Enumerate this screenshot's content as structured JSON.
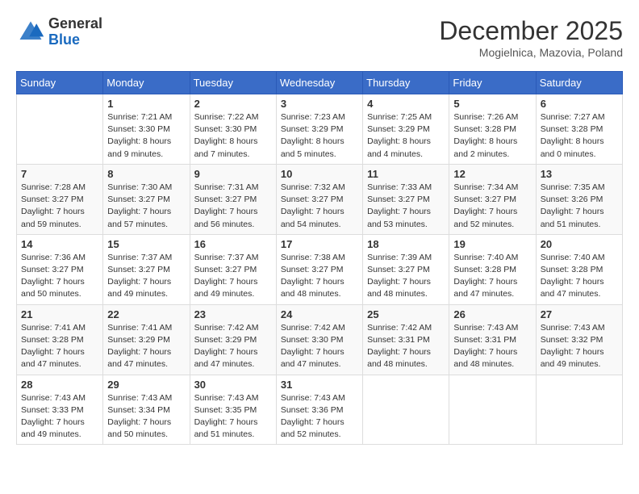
{
  "header": {
    "logo": {
      "general": "General",
      "blue": "Blue"
    },
    "title": "December 2025",
    "subtitle": "Mogielnica, Mazovia, Poland"
  },
  "calendar": {
    "weekdays": [
      "Sunday",
      "Monday",
      "Tuesday",
      "Wednesday",
      "Thursday",
      "Friday",
      "Saturday"
    ],
    "weeks": [
      [
        {
          "day": "",
          "sunrise": "",
          "sunset": "",
          "daylight": ""
        },
        {
          "day": "1",
          "sunrise": "Sunrise: 7:21 AM",
          "sunset": "Sunset: 3:30 PM",
          "daylight": "Daylight: 8 hours and 9 minutes."
        },
        {
          "day": "2",
          "sunrise": "Sunrise: 7:22 AM",
          "sunset": "Sunset: 3:30 PM",
          "daylight": "Daylight: 8 hours and 7 minutes."
        },
        {
          "day": "3",
          "sunrise": "Sunrise: 7:23 AM",
          "sunset": "Sunset: 3:29 PM",
          "daylight": "Daylight: 8 hours and 5 minutes."
        },
        {
          "day": "4",
          "sunrise": "Sunrise: 7:25 AM",
          "sunset": "Sunset: 3:29 PM",
          "daylight": "Daylight: 8 hours and 4 minutes."
        },
        {
          "day": "5",
          "sunrise": "Sunrise: 7:26 AM",
          "sunset": "Sunset: 3:28 PM",
          "daylight": "Daylight: 8 hours and 2 minutes."
        },
        {
          "day": "6",
          "sunrise": "Sunrise: 7:27 AM",
          "sunset": "Sunset: 3:28 PM",
          "daylight": "Daylight: 8 hours and 0 minutes."
        }
      ],
      [
        {
          "day": "7",
          "sunrise": "Sunrise: 7:28 AM",
          "sunset": "Sunset: 3:27 PM",
          "daylight": "Daylight: 7 hours and 59 minutes."
        },
        {
          "day": "8",
          "sunrise": "Sunrise: 7:30 AM",
          "sunset": "Sunset: 3:27 PM",
          "daylight": "Daylight: 7 hours and 57 minutes."
        },
        {
          "day": "9",
          "sunrise": "Sunrise: 7:31 AM",
          "sunset": "Sunset: 3:27 PM",
          "daylight": "Daylight: 7 hours and 56 minutes."
        },
        {
          "day": "10",
          "sunrise": "Sunrise: 7:32 AM",
          "sunset": "Sunset: 3:27 PM",
          "daylight": "Daylight: 7 hours and 54 minutes."
        },
        {
          "day": "11",
          "sunrise": "Sunrise: 7:33 AM",
          "sunset": "Sunset: 3:27 PM",
          "daylight": "Daylight: 7 hours and 53 minutes."
        },
        {
          "day": "12",
          "sunrise": "Sunrise: 7:34 AM",
          "sunset": "Sunset: 3:27 PM",
          "daylight": "Daylight: 7 hours and 52 minutes."
        },
        {
          "day": "13",
          "sunrise": "Sunrise: 7:35 AM",
          "sunset": "Sunset: 3:26 PM",
          "daylight": "Daylight: 7 hours and 51 minutes."
        }
      ],
      [
        {
          "day": "14",
          "sunrise": "Sunrise: 7:36 AM",
          "sunset": "Sunset: 3:27 PM",
          "daylight": "Daylight: 7 hours and 50 minutes."
        },
        {
          "day": "15",
          "sunrise": "Sunrise: 7:37 AM",
          "sunset": "Sunset: 3:27 PM",
          "daylight": "Daylight: 7 hours and 49 minutes."
        },
        {
          "day": "16",
          "sunrise": "Sunrise: 7:37 AM",
          "sunset": "Sunset: 3:27 PM",
          "daylight": "Daylight: 7 hours and 49 minutes."
        },
        {
          "day": "17",
          "sunrise": "Sunrise: 7:38 AM",
          "sunset": "Sunset: 3:27 PM",
          "daylight": "Daylight: 7 hours and 48 minutes."
        },
        {
          "day": "18",
          "sunrise": "Sunrise: 7:39 AM",
          "sunset": "Sunset: 3:27 PM",
          "daylight": "Daylight: 7 hours and 48 minutes."
        },
        {
          "day": "19",
          "sunrise": "Sunrise: 7:40 AM",
          "sunset": "Sunset: 3:28 PM",
          "daylight": "Daylight: 7 hours and 47 minutes."
        },
        {
          "day": "20",
          "sunrise": "Sunrise: 7:40 AM",
          "sunset": "Sunset: 3:28 PM",
          "daylight": "Daylight: 7 hours and 47 minutes."
        }
      ],
      [
        {
          "day": "21",
          "sunrise": "Sunrise: 7:41 AM",
          "sunset": "Sunset: 3:28 PM",
          "daylight": "Daylight: 7 hours and 47 minutes."
        },
        {
          "day": "22",
          "sunrise": "Sunrise: 7:41 AM",
          "sunset": "Sunset: 3:29 PM",
          "daylight": "Daylight: 7 hours and 47 minutes."
        },
        {
          "day": "23",
          "sunrise": "Sunrise: 7:42 AM",
          "sunset": "Sunset: 3:29 PM",
          "daylight": "Daylight: 7 hours and 47 minutes."
        },
        {
          "day": "24",
          "sunrise": "Sunrise: 7:42 AM",
          "sunset": "Sunset: 3:30 PM",
          "daylight": "Daylight: 7 hours and 47 minutes."
        },
        {
          "day": "25",
          "sunrise": "Sunrise: 7:42 AM",
          "sunset": "Sunset: 3:31 PM",
          "daylight": "Daylight: 7 hours and 48 minutes."
        },
        {
          "day": "26",
          "sunrise": "Sunrise: 7:43 AM",
          "sunset": "Sunset: 3:31 PM",
          "daylight": "Daylight: 7 hours and 48 minutes."
        },
        {
          "day": "27",
          "sunrise": "Sunrise: 7:43 AM",
          "sunset": "Sunset: 3:32 PM",
          "daylight": "Daylight: 7 hours and 49 minutes."
        }
      ],
      [
        {
          "day": "28",
          "sunrise": "Sunrise: 7:43 AM",
          "sunset": "Sunset: 3:33 PM",
          "daylight": "Daylight: 7 hours and 49 minutes."
        },
        {
          "day": "29",
          "sunrise": "Sunrise: 7:43 AM",
          "sunset": "Sunset: 3:34 PM",
          "daylight": "Daylight: 7 hours and 50 minutes."
        },
        {
          "day": "30",
          "sunrise": "Sunrise: 7:43 AM",
          "sunset": "Sunset: 3:35 PM",
          "daylight": "Daylight: 7 hours and 51 minutes."
        },
        {
          "day": "31",
          "sunrise": "Sunrise: 7:43 AM",
          "sunset": "Sunset: 3:36 PM",
          "daylight": "Daylight: 7 hours and 52 minutes."
        },
        {
          "day": "",
          "sunrise": "",
          "sunset": "",
          "daylight": ""
        },
        {
          "day": "",
          "sunrise": "",
          "sunset": "",
          "daylight": ""
        },
        {
          "day": "",
          "sunrise": "",
          "sunset": "",
          "daylight": ""
        }
      ]
    ]
  }
}
